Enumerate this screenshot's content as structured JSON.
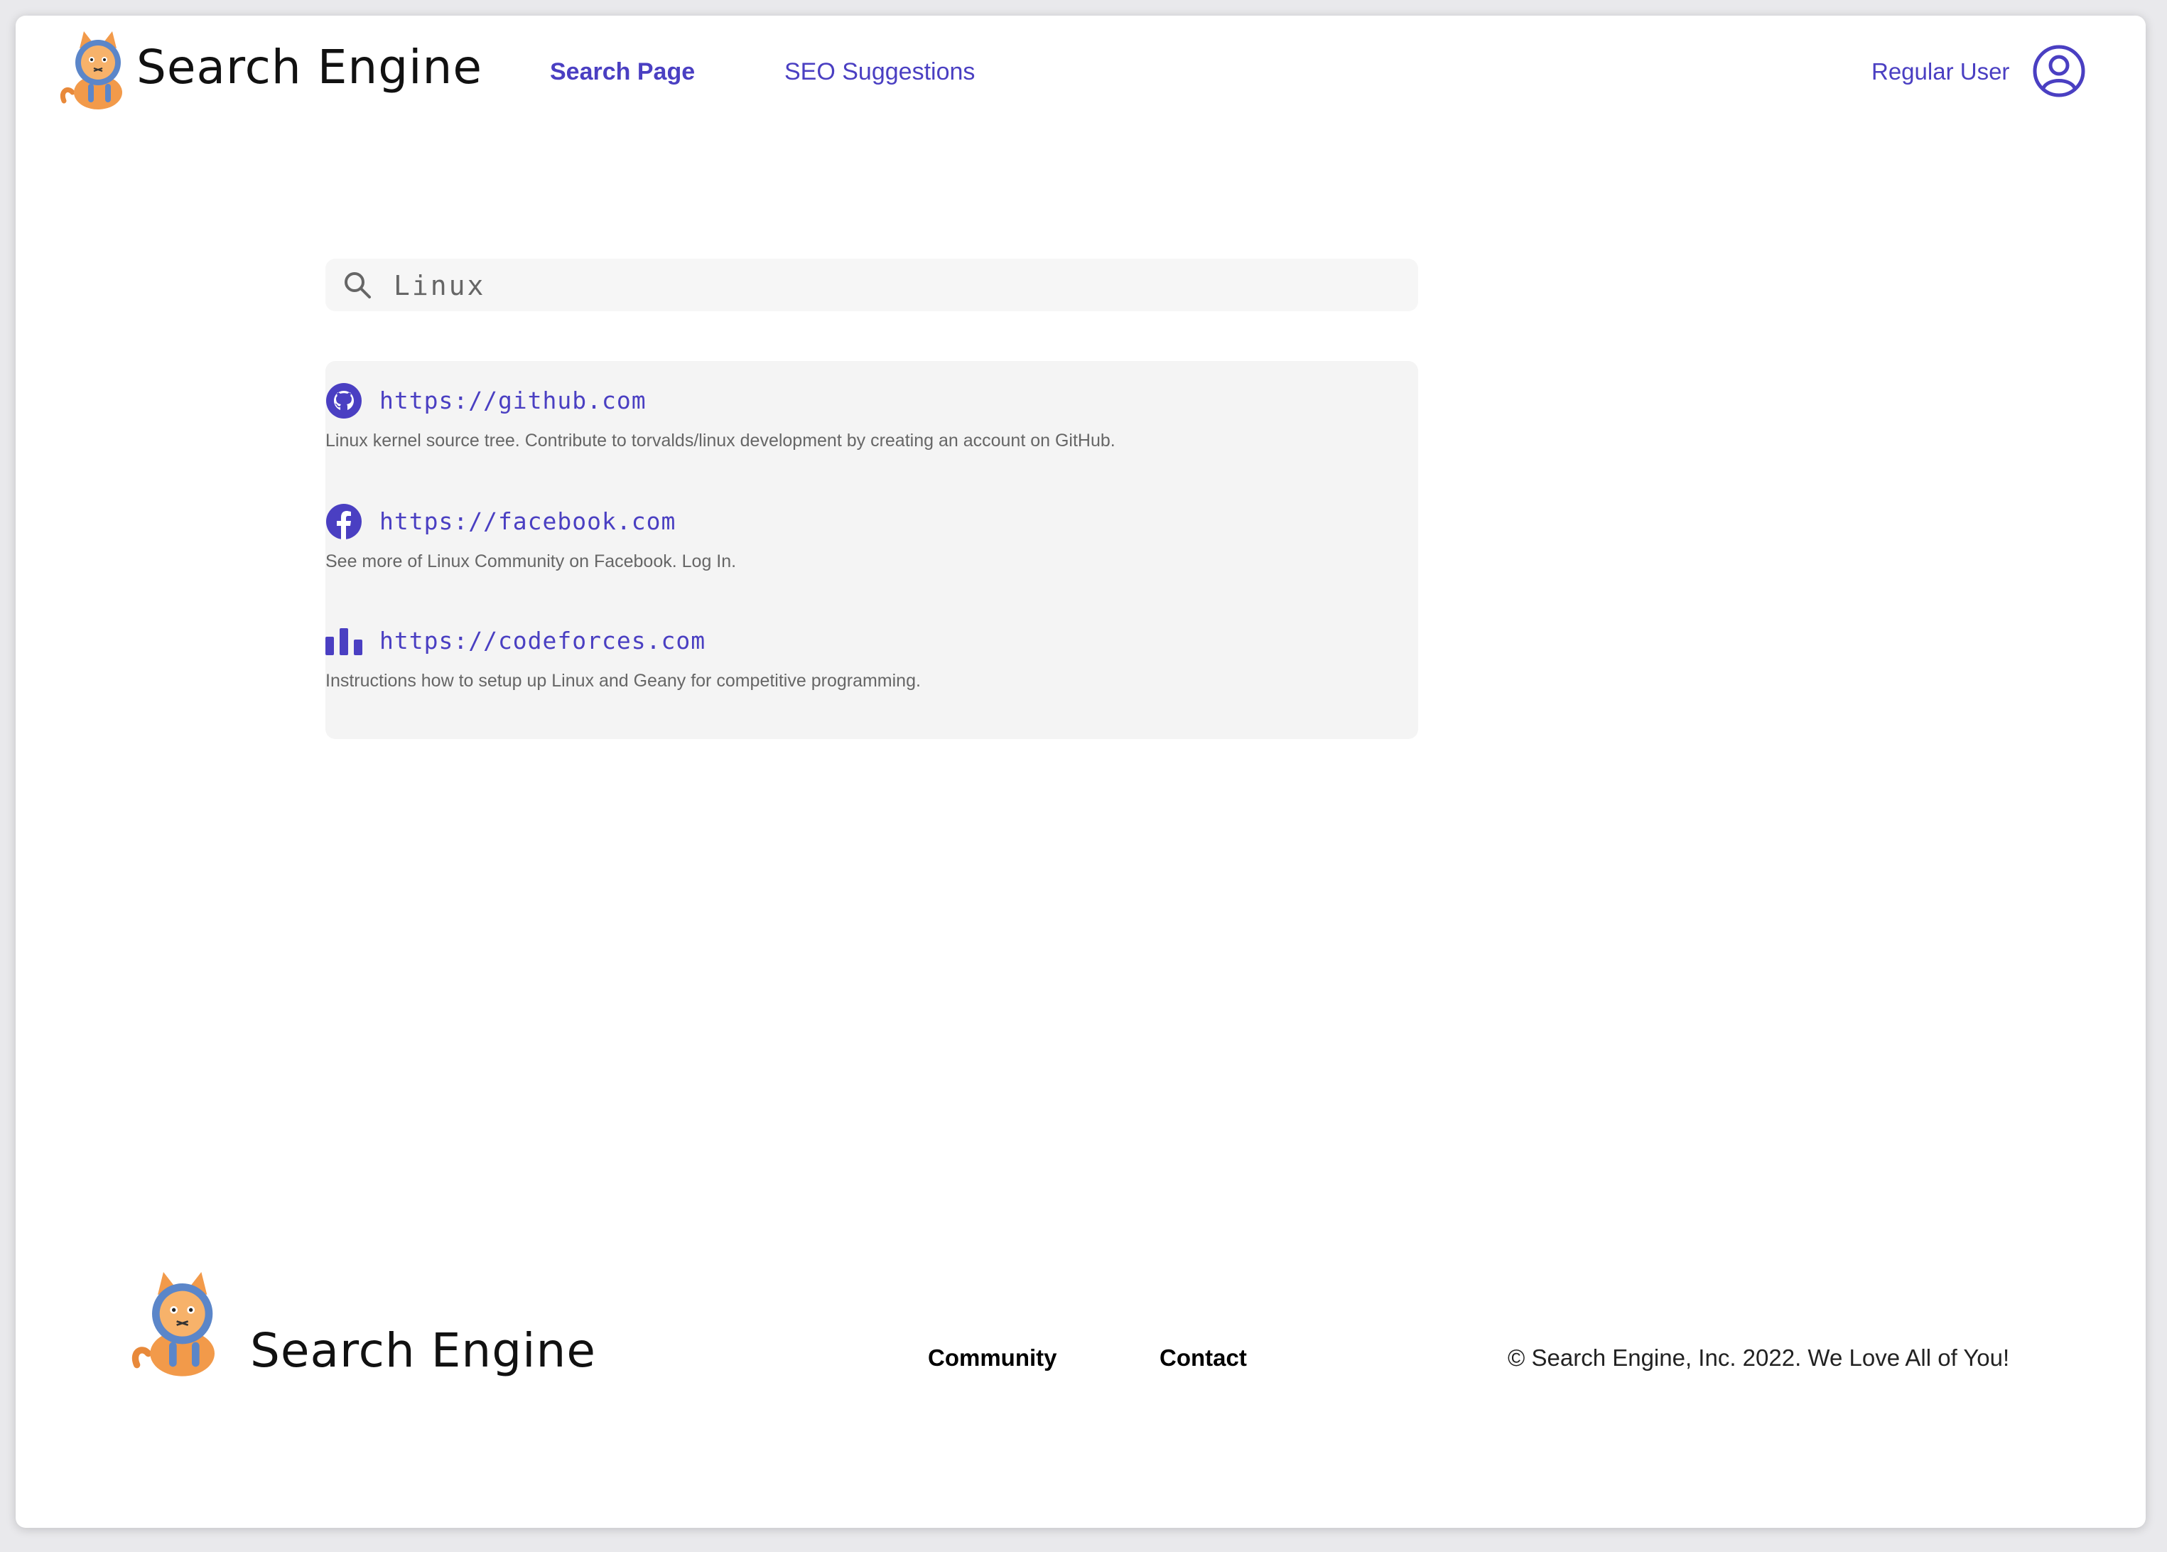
{
  "header": {
    "brand": "Search Engine",
    "nav": {
      "search_page": "Search Page",
      "seo_suggestions": "SEO Suggestions"
    },
    "user": {
      "name": "Regular User",
      "icon": "user-circle-icon"
    }
  },
  "search": {
    "icon": "search-icon",
    "value": "Linux"
  },
  "results": [
    {
      "icon": "github-icon",
      "url": "https://github.com",
      "description": "Linux kernel source tree. Contribute to torvalds/linux development by creating an account on GitHub."
    },
    {
      "icon": "facebook-icon",
      "url": "https://facebook.com",
      "description": "See more of Linux Community on Facebook. Log In."
    },
    {
      "icon": "bar-chart-icon",
      "url": "https://codeforces.com",
      "description": "Instructions how to setup up Linux and Geany for competitive programming."
    }
  ],
  "footer": {
    "brand": "Search Engine",
    "links": {
      "community": "Community",
      "contact": "Contact"
    },
    "copyright": "© Search Engine, Inc. 2022.  We Love All of You!"
  },
  "colors": {
    "accent": "#4a3fc2",
    "result_panel": "#f4f4f4",
    "search_bg": "#f6f6f6"
  }
}
